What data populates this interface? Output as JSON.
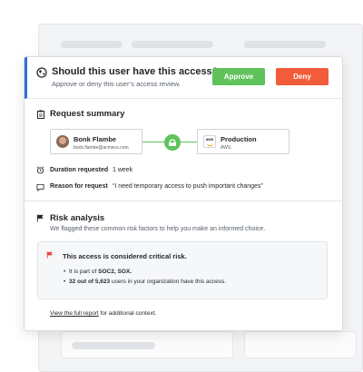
{
  "header": {
    "title": "Should this user have this access?",
    "subtitle": "Approve or deny this user’s access review.",
    "approve_label": "Approve",
    "deny_label": "Deny"
  },
  "request_summary": {
    "title": "Request summary",
    "user": {
      "name": "Bonk Flambe",
      "email": "bonk.flambe@acmeco.com"
    },
    "resource": {
      "name": "Production",
      "provider": "AWS",
      "logo_text": "aws"
    },
    "duration_label": "Duration requested",
    "duration_value": "1 week",
    "reason_label": "Reason for request",
    "reason_value": "“I need temporary access to push important changes”"
  },
  "risk_analysis": {
    "title": "Risk analysis",
    "intro": "We flagged these common risk factors to help you make an informed choice.",
    "box_title": "This access is considered critical risk.",
    "item1_prefix": "It is part of ",
    "item1_bold": "SOC2, SOX.",
    "item2_bold": "32 out of 5,623",
    "item2_rest": " users in your organization have this access.",
    "footer_link": "View the full report",
    "footer_rest": " for additional context."
  },
  "colors": {
    "accent": "#2f6fd6",
    "approve": "#5fc25b",
    "deny": "#f25c3a",
    "risk_flag": "#e8483a"
  }
}
